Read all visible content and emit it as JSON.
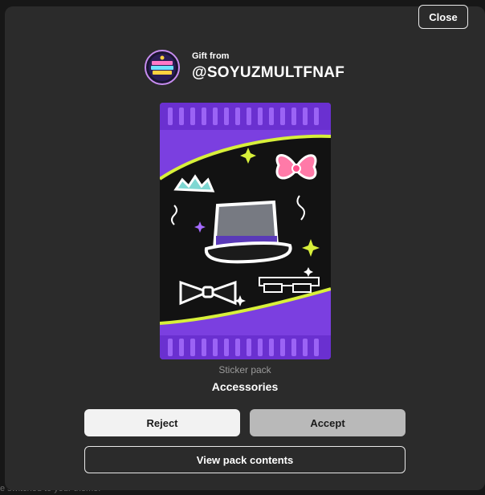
{
  "modal": {
    "close_label": "Close",
    "gift_from_label": "Gift from",
    "sender_username": "@SOYUZMULTFNAF",
    "pack_kind": "Sticker pack",
    "pack_name": "Accessories",
    "reject_label": "Reject",
    "accept_label": "Accept",
    "view_contents_label": "View pack contents"
  },
  "background": {
    "partial_text": "e switched to your theme."
  },
  "colors": {
    "modal_bg": "#2b2b2b",
    "pack_purple": "#7b3fe0",
    "pack_lime": "#d8f03a",
    "accept_bg": "#b9b9b9",
    "reject_bg": "#f2f2f2"
  },
  "icons": {
    "avatar": "sender-avatar-icon",
    "pack_art": "sticker-pack-art"
  }
}
